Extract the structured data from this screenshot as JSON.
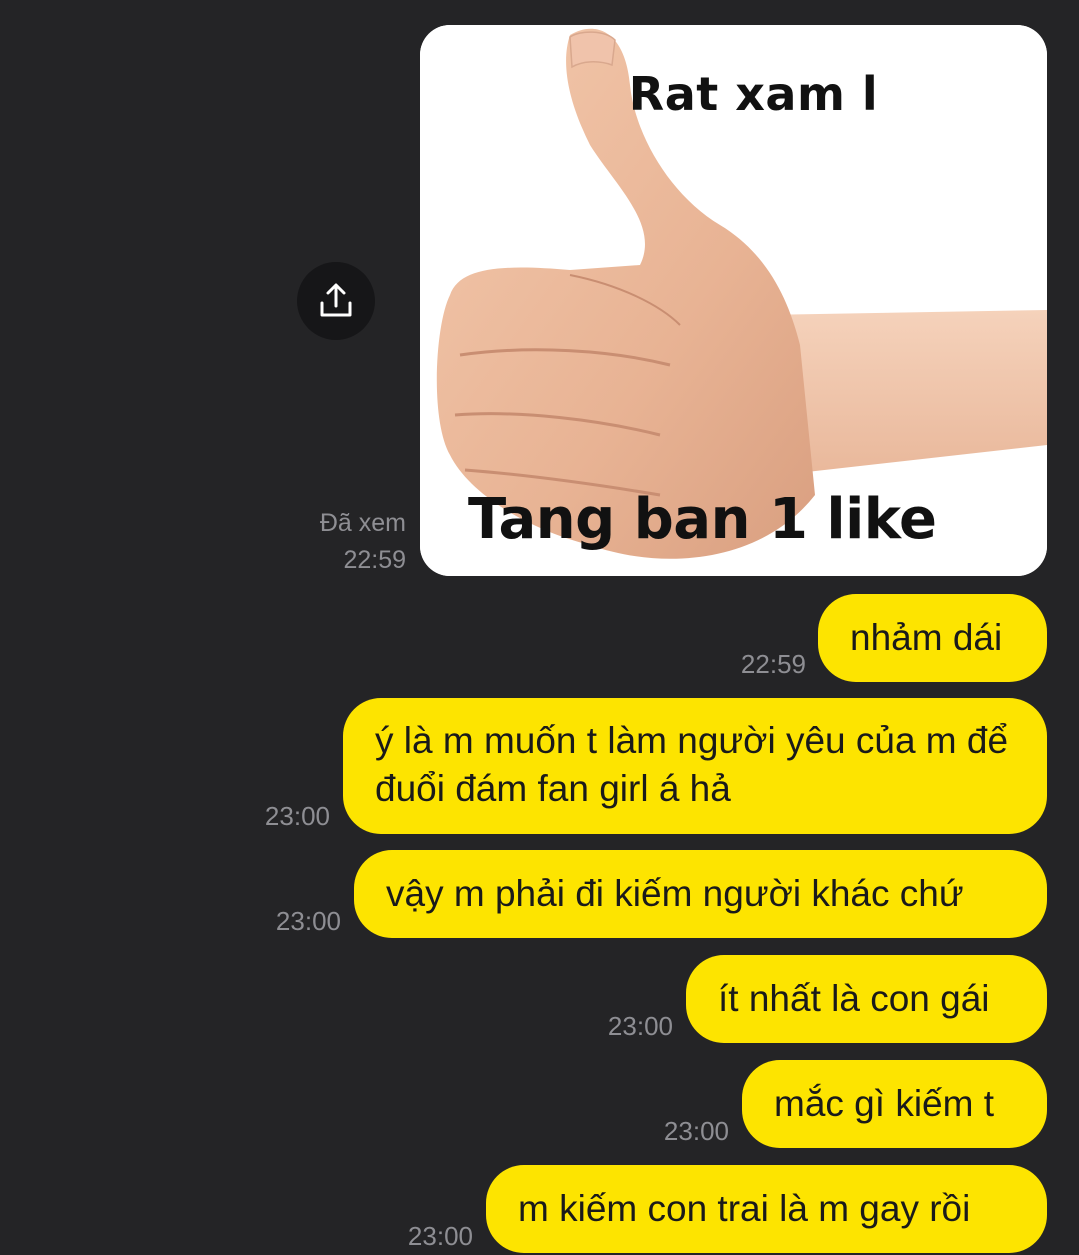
{
  "image_message": {
    "top_text": "Rat xam l",
    "bottom_text": "Tang ban 1 like",
    "status": "Đã xem",
    "time": "22:59"
  },
  "share_icon": "share-upload-icon",
  "messages": [
    {
      "text": "nhảm dái",
      "time": "22:59"
    },
    {
      "text": "ý là m muốn t làm người yêu của m để đuổi đám fan girl á hả",
      "time": "23:00"
    },
    {
      "text": "vậy m phải đi kiếm người khác chứ",
      "time": "23:00"
    },
    {
      "text": "ít nhất là con gái",
      "time": "23:00"
    },
    {
      "text": "mắc gì kiếm t",
      "time": "23:00"
    },
    {
      "text": "m kiếm con trai là m gay rồi",
      "time": "23:00"
    }
  ],
  "colors": {
    "background": "#242426",
    "bubble": "#fde400",
    "meta_text": "#8e8e93"
  }
}
